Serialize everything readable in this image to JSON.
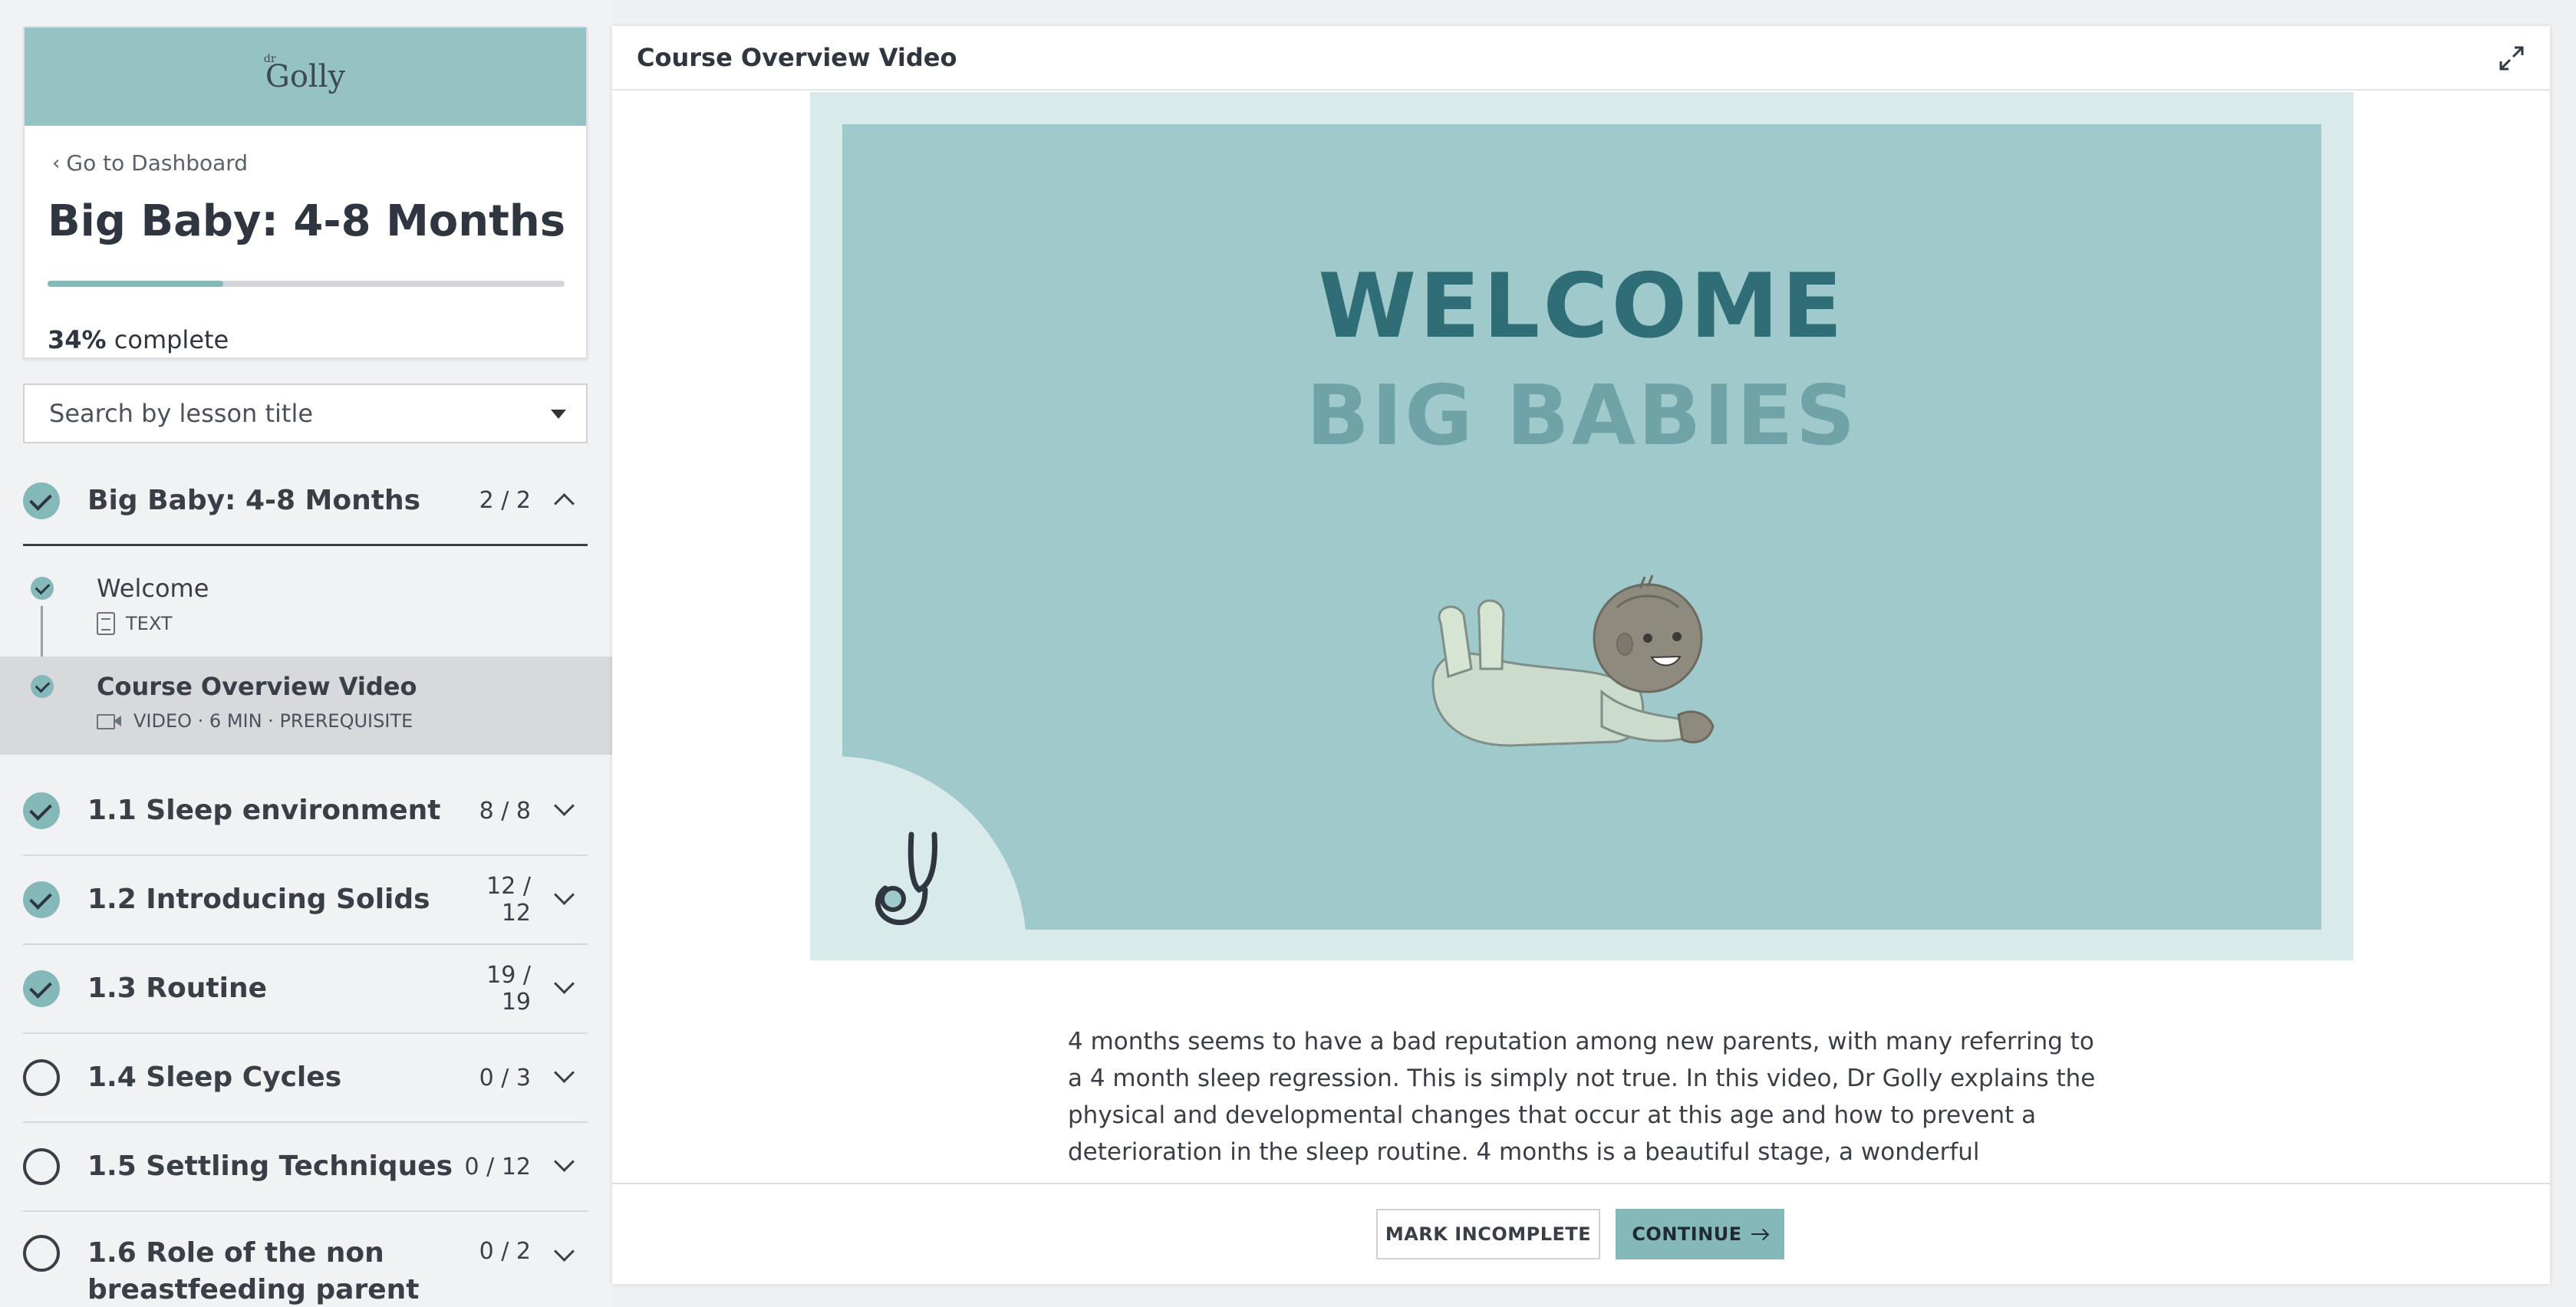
{
  "sidebar": {
    "logo_prefix": "dr",
    "logo_text": "Golly",
    "back_link": "Go to Dashboard",
    "course_title": "Big Baby: 4-8 Months",
    "progress_percent_label": "34%",
    "progress_suffix": "complete",
    "progress_fraction": 0.34,
    "search_placeholder": "Search by lesson title",
    "sections": [
      {
        "title": "Big Baby: 4-8 Months",
        "count": "2 / 2",
        "status": "done",
        "expanded": true
      },
      {
        "title": "1.1 Sleep environment",
        "count": "8 / 8",
        "status": "done",
        "expanded": false
      },
      {
        "title": "1.2 Introducing Solids",
        "count": "12 / 12",
        "status": "done",
        "expanded": false
      },
      {
        "title": "1.3 Routine",
        "count": "19 / 19",
        "status": "done",
        "expanded": false
      },
      {
        "title": "1.4 Sleep Cycles",
        "count": "0 / 3",
        "status": "todo",
        "expanded": false
      },
      {
        "title": "1.5 Settling Techniques",
        "count": "0 / 12",
        "status": "todo",
        "expanded": false
      },
      {
        "title": "1.6 Role of the non breastfeeding parent",
        "count": "0 / 2",
        "status": "todo",
        "expanded": false
      }
    ],
    "lessons": [
      {
        "title": "Welcome",
        "meta": "TEXT",
        "icon": "document-icon",
        "active": false
      },
      {
        "title": "Course Overview Video",
        "meta": "VIDEO · 6 MIN · PREREQUISITE",
        "icon": "video-camera-icon",
        "active": true
      }
    ]
  },
  "main": {
    "title": "Course Overview Video",
    "slide": {
      "line1": "WELCOME",
      "line2": "BIG BABIES"
    },
    "description": "4 months seems to have a bad reputation among new parents, with many referring to a 4 month sleep regression. This is simply not true. In this video, Dr Golly explains the physical and developmental changes that occur at this age and how to prevent a deterioration in the sleep routine. 4 months is a beautiful stage, a wonderful progression - not a necessary",
    "buttons": {
      "mark_incomplete": "MARK INCOMPLETE",
      "continue": "CONTINUE"
    }
  },
  "colors": {
    "accent": "#84b8b9",
    "brand_bar": "#95c2c3",
    "slide_bg": "#a0c9cb",
    "welcome_text": "#2f6e76",
    "big_babies_text": "#6fa3a7"
  }
}
